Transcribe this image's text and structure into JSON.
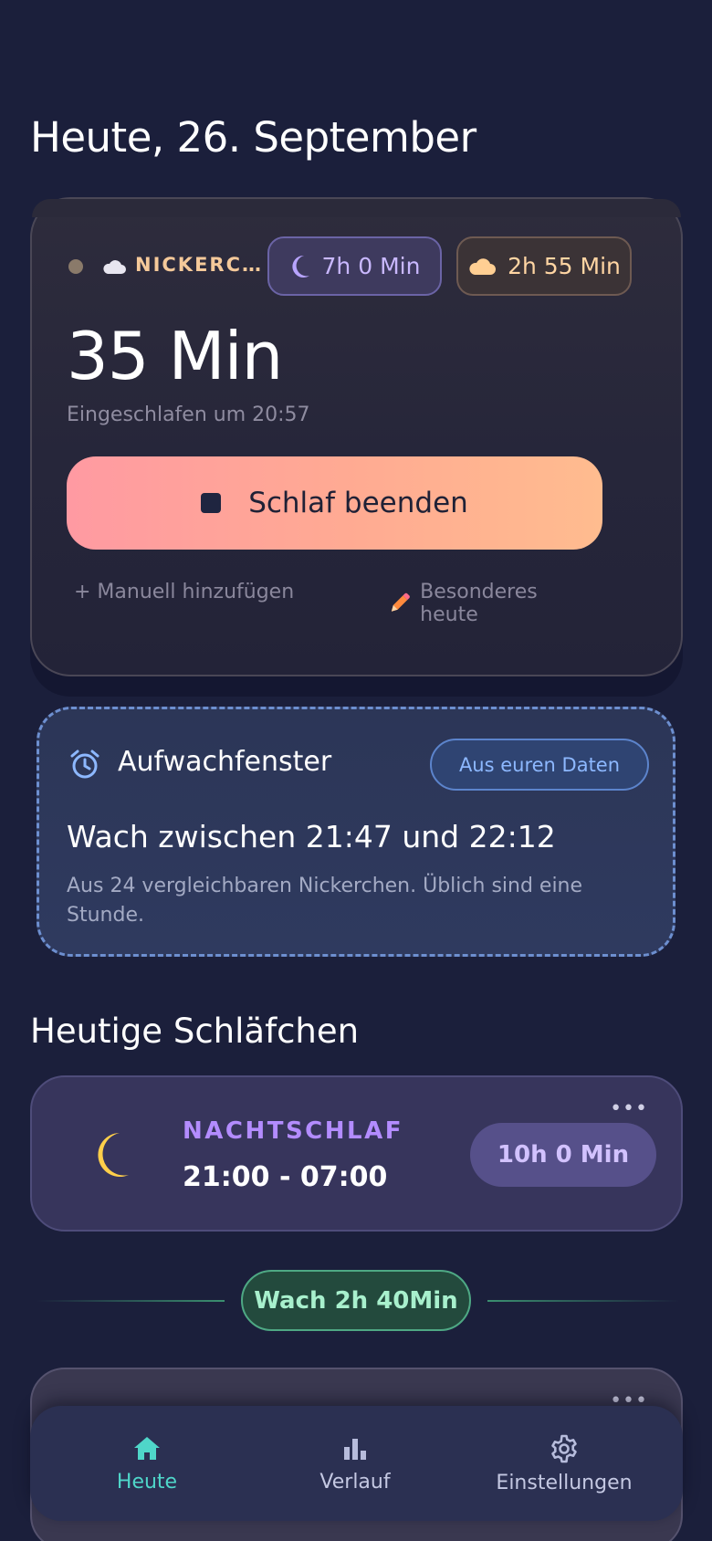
{
  "header": {
    "title": "Heute, 26. September"
  },
  "active_sleep": {
    "status_label": "NICKERCH…",
    "night_pill": {
      "icon": "moon-icon",
      "label": "7h 0 Min"
    },
    "nap_pill": {
      "icon": "cloud-icon",
      "label": "2h 55 Min"
    },
    "elapsed": "35 Min",
    "asleep_at": "Eingeschlafen um 20:57",
    "end_button_label": "Schlaf beenden",
    "add_manual_label": "+ Manuell hinzufügen",
    "special_today_label": "Besonderes heute"
  },
  "wake_window": {
    "icon": "alarm-clock-icon",
    "title": "Aufwachfenster",
    "chip": "Aus euren Daten",
    "range": "Wach zwischen 21:47 und 22:12",
    "note": "Aus 24 vergleichbaren Nickerchen. Üblich sind eine Stunde."
  },
  "naps_section": {
    "title": "Heutige Schläfchen",
    "entries": [
      {
        "kind": "NACHTSCHLAF",
        "time": "21:00 - 07:00",
        "duration": "10h 0 Min",
        "icon": "moon-icon",
        "more": "•••"
      }
    ],
    "awake_chip": "Wach 2h 40Min",
    "second_entry_more": "•••"
  },
  "bottom_nav": {
    "items": [
      {
        "label": "Heute",
        "icon": "home-icon",
        "active": true
      },
      {
        "label": "Verlauf",
        "icon": "bar-chart-icon",
        "active": false
      },
      {
        "label": "Einstellungen",
        "icon": "gear-icon",
        "active": false
      }
    ]
  },
  "colors": {
    "background": "#1b1f3b",
    "accent_teal": "#4fd6c9",
    "night_purple": "#b38cff",
    "nap_peach": "#ffbc8f",
    "awake_green": "#4ea884",
    "wake_blue": "#6d8fd0"
  }
}
